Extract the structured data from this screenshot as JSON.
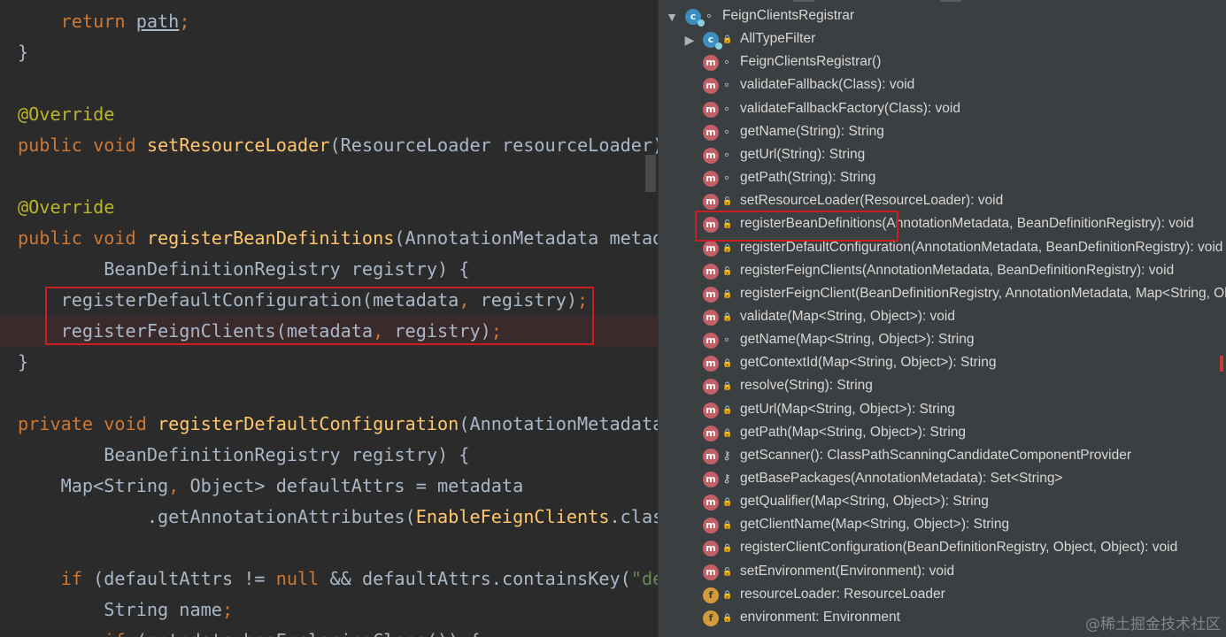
{
  "editor": {
    "lines": [
      {
        "highlighted": false,
        "tokens": [
          [
            "pl",
            "    "
          ],
          [
            "kw",
            "return "
          ],
          [
            "ul",
            "path"
          ],
          [
            "pn",
            ";"
          ]
        ]
      },
      {
        "highlighted": false,
        "tokens": [
          [
            "pl",
            "}"
          ]
        ]
      },
      {
        "highlighted": false,
        "tokens": []
      },
      {
        "highlighted": false,
        "tokens": [
          [
            "an",
            "@Override"
          ]
        ]
      },
      {
        "highlighted": false,
        "tokens": [
          [
            "kw",
            "public void "
          ],
          [
            "fn",
            "setResourceLoader"
          ],
          [
            "pl",
            "(ResourceLoader resourceLoader)"
          ]
        ]
      },
      {
        "highlighted": false,
        "tokens": []
      },
      {
        "highlighted": false,
        "tokens": [
          [
            "an",
            "@Override"
          ]
        ]
      },
      {
        "highlighted": false,
        "tokens": [
          [
            "kw",
            "public void "
          ],
          [
            "fn",
            "registerBeanDefinitions"
          ],
          [
            "pl",
            "(AnnotationMetadata metada"
          ]
        ]
      },
      {
        "highlighted": false,
        "tokens": [
          [
            "pl",
            "        BeanDefinitionRegistry registry) {"
          ]
        ]
      },
      {
        "highlighted": false,
        "tokens": [
          [
            "pl",
            "    registerDefaultConfiguration(metadata"
          ],
          [
            "pn",
            ", "
          ],
          [
            "pl",
            "registry)"
          ],
          [
            "pn",
            ";"
          ]
        ]
      },
      {
        "highlighted": true,
        "tokens": [
          [
            "pl",
            "    registerFeignClients(metadata"
          ],
          [
            "pn",
            ", "
          ],
          [
            "pl",
            "registry)"
          ],
          [
            "pn",
            ";"
          ]
        ]
      },
      {
        "highlighted": false,
        "tokens": [
          [
            "pl",
            "}"
          ]
        ]
      },
      {
        "highlighted": false,
        "tokens": []
      },
      {
        "highlighted": false,
        "tokens": [
          [
            "kw",
            "private void "
          ],
          [
            "fn",
            "registerDefaultConfiguration"
          ],
          [
            "pl",
            "(AnnotationMetadata"
          ]
        ]
      },
      {
        "highlighted": false,
        "tokens": [
          [
            "pl",
            "        BeanDefinitionRegistry registry) {"
          ]
        ]
      },
      {
        "highlighted": false,
        "tokens": [
          [
            "pl",
            "    Map<String"
          ],
          [
            "pn",
            ", "
          ],
          [
            "pl",
            "Object> defaultAttrs = metadata"
          ]
        ]
      },
      {
        "highlighted": false,
        "tokens": [
          [
            "pl",
            "            .getAnnotationAttributes("
          ],
          [
            "hc",
            "EnableFeignClients"
          ],
          [
            "pl",
            ".class"
          ]
        ]
      },
      {
        "highlighted": false,
        "tokens": []
      },
      {
        "highlighted": false,
        "tokens": [
          [
            "pl",
            "    "
          ],
          [
            "kw",
            "if "
          ],
          [
            "pl",
            "(defaultAttrs != "
          ],
          [
            "kw",
            "null "
          ],
          [
            "pl",
            "&& defaultAttrs.containsKey("
          ],
          [
            "st",
            "\"def"
          ]
        ]
      },
      {
        "highlighted": false,
        "tokens": [
          [
            "pl",
            "        String name"
          ],
          [
            "pn",
            ";"
          ]
        ]
      },
      {
        "highlighted": false,
        "tokens": [
          [
            "pl",
            "        "
          ],
          [
            "kw",
            "if "
          ],
          [
            "pl",
            "(metadata.hasEnclosingClass()) {"
          ]
        ]
      }
    ]
  },
  "structure": {
    "items": [
      {
        "depth": 0,
        "arrow": "▼",
        "icon": "c",
        "modifier": "dot",
        "label": "FeignClientsRegistrar"
      },
      {
        "depth": 1,
        "arrow": "▶",
        "icon": "c",
        "modifier": "lock-red",
        "label": "AllTypeFilter"
      },
      {
        "depth": 1,
        "arrow": "",
        "icon": "m",
        "modifier": "dot",
        "label": "FeignClientsRegistrar()"
      },
      {
        "depth": 1,
        "arrow": "",
        "icon": "m",
        "modifier": "dot",
        "label": "validateFallback(Class): void"
      },
      {
        "depth": 1,
        "arrow": "",
        "icon": "m",
        "modifier": "dot",
        "label": "validateFallbackFactory(Class): void"
      },
      {
        "depth": 1,
        "arrow": "",
        "icon": "m",
        "modifier": "dot",
        "label": "getName(String): String"
      },
      {
        "depth": 1,
        "arrow": "",
        "icon": "m",
        "modifier": "dot",
        "label": "getUrl(String): String"
      },
      {
        "depth": 1,
        "arrow": "",
        "icon": "m",
        "modifier": "dot",
        "label": "getPath(String): String"
      },
      {
        "depth": 1,
        "arrow": "",
        "icon": "m",
        "modifier": "lock-green",
        "label": "setResourceLoader(ResourceLoader): void"
      },
      {
        "depth": 1,
        "arrow": "",
        "icon": "m",
        "modifier": "lock-green",
        "label": "registerBeanDefinitions(AnnotationMetadata, BeanDefinitionRegistry): void"
      },
      {
        "depth": 1,
        "arrow": "",
        "icon": "m",
        "modifier": "lock-red",
        "label": "registerDefaultConfiguration(AnnotationMetadata, BeanDefinitionRegistry): void"
      },
      {
        "depth": 1,
        "arrow": "",
        "icon": "m",
        "modifier": "lock-green",
        "label": "registerFeignClients(AnnotationMetadata, BeanDefinitionRegistry): void"
      },
      {
        "depth": 1,
        "arrow": "",
        "icon": "m",
        "modifier": "lock-red",
        "label": "registerFeignClient(BeanDefinitionRegistry, AnnotationMetadata, Map<String, Object>): void"
      },
      {
        "depth": 1,
        "arrow": "",
        "icon": "m",
        "modifier": "lock-red",
        "label": "validate(Map<String, Object>): void"
      },
      {
        "depth": 1,
        "arrow": "",
        "icon": "m",
        "modifier": "dot",
        "label": "getName(Map<String, Object>): String"
      },
      {
        "depth": 1,
        "arrow": "",
        "icon": "m",
        "modifier": "lock-red",
        "label": "getContextId(Map<String, Object>): String"
      },
      {
        "depth": 1,
        "arrow": "",
        "icon": "m",
        "modifier": "lock-red",
        "label": "resolve(String): String"
      },
      {
        "depth": 1,
        "arrow": "",
        "icon": "m",
        "modifier": "lock-red",
        "label": "getUrl(Map<String, Object>): String"
      },
      {
        "depth": 1,
        "arrow": "",
        "icon": "m",
        "modifier": "lock-red",
        "label": "getPath(Map<String, Object>): String"
      },
      {
        "depth": 1,
        "arrow": "",
        "icon": "m",
        "modifier": "key",
        "label": "getScanner(): ClassPathScanningCandidateComponentProvider"
      },
      {
        "depth": 1,
        "arrow": "",
        "icon": "m",
        "modifier": "key",
        "label": "getBasePackages(AnnotationMetadata): Set<String>"
      },
      {
        "depth": 1,
        "arrow": "",
        "icon": "m",
        "modifier": "lock-red",
        "label": "getQualifier(Map<String, Object>): String"
      },
      {
        "depth": 1,
        "arrow": "",
        "icon": "m",
        "modifier": "lock-red",
        "label": "getClientName(Map<String, Object>): String"
      },
      {
        "depth": 1,
        "arrow": "",
        "icon": "m",
        "modifier": "lock-red",
        "label": "registerClientConfiguration(BeanDefinitionRegistry, Object, Object): void"
      },
      {
        "depth": 1,
        "arrow": "",
        "icon": "m",
        "modifier": "lock-green",
        "label": "setEnvironment(Environment): void"
      },
      {
        "depth": 1,
        "arrow": "",
        "icon": "f",
        "modifier": "lock-red",
        "label": "resourceLoader: ResourceLoader"
      },
      {
        "depth": 1,
        "arrow": "",
        "icon": "f",
        "modifier": "lock-red",
        "label": "environment: Environment"
      }
    ]
  },
  "watermark": "@稀土掘金技术社区"
}
